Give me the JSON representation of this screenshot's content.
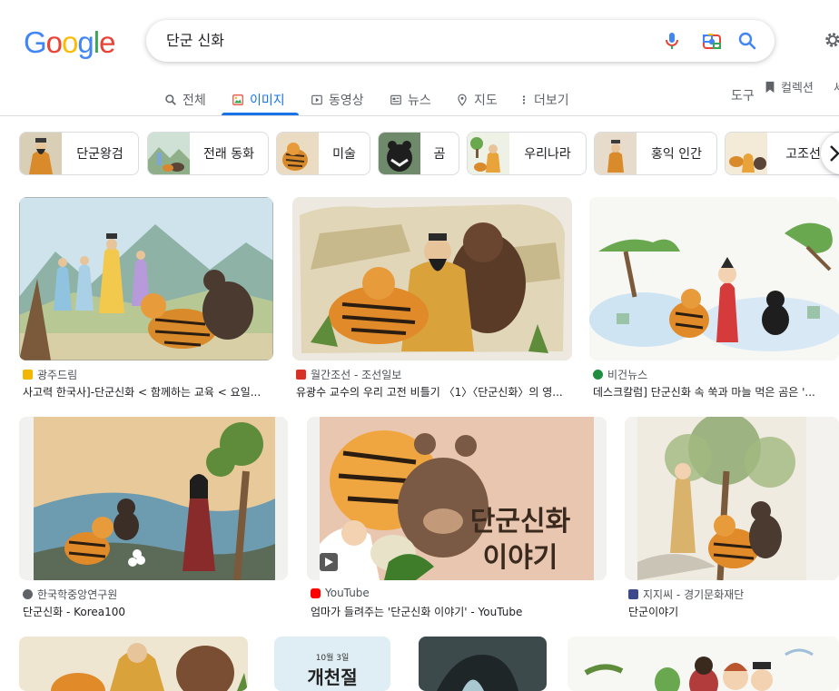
{
  "logo": {
    "letters": [
      "G",
      "o",
      "o",
      "g",
      "l",
      "e"
    ],
    "colors": [
      "#4285f4",
      "#ea4335",
      "#fbbc05",
      "#4285f4",
      "#34a853",
      "#ea4335"
    ]
  },
  "search": {
    "query": "단군 신화"
  },
  "nav": {
    "tabs": [
      {
        "label": "전체",
        "icon": "search-icon"
      },
      {
        "label": "이미지",
        "icon": "image-icon",
        "active": true
      },
      {
        "label": "동영상",
        "icon": "play-icon"
      },
      {
        "label": "뉴스",
        "icon": "news-icon"
      },
      {
        "label": "지도",
        "icon": "map-pin-icon"
      },
      {
        "label": "더보기",
        "icon": "more-vert-icon"
      }
    ],
    "tools": "도구",
    "collections": "컬렉션",
    "safesearch": "세"
  },
  "chips": [
    {
      "label": "단군왕검"
    },
    {
      "label": "전래 동화"
    },
    {
      "label": "미술"
    },
    {
      "label": "곰"
    },
    {
      "label": "우리나라"
    },
    {
      "label": "홍익 인간"
    },
    {
      "label": "고조선건"
    }
  ],
  "results": [
    {
      "source": "광주드림",
      "title": "사고력 한국사]-단군신화 < 함께하는 교육 < 요일...",
      "fav_color": "#f2b705"
    },
    {
      "source": "월간조선 - 조선일보",
      "title": "유광수 교수의 우리 고전 비틀기 〈1〉〈단군신화〉의 영...",
      "fav_color": "#d93025"
    },
    {
      "source": "비건뉴스",
      "title": "데스크칼럼] 단군신화 속 쑥과 마늘 먹은 곰은 '...",
      "fav_color": "#1e8e3e"
    },
    {
      "source": "한국학중앙연구원",
      "title": "단군신화 - Korea100",
      "fav_color": "#5f6368"
    },
    {
      "source": "YouTube",
      "title": "엄마가 들려주는 '단군신화 이야기' - YouTube",
      "fav_color": "#ff0000"
    },
    {
      "source": "지지씨 - 경기문화재단",
      "title": "단군이야기",
      "fav_color": "#3c4a8c"
    }
  ],
  "thumb_texts": {
    "youtube_title": "단군신화 이야기",
    "youtube_title_line1": "단군신화",
    "youtube_title_line2": "이야기",
    "gaecheon_date": "10월 3일",
    "gaecheon_title": "개천절"
  }
}
